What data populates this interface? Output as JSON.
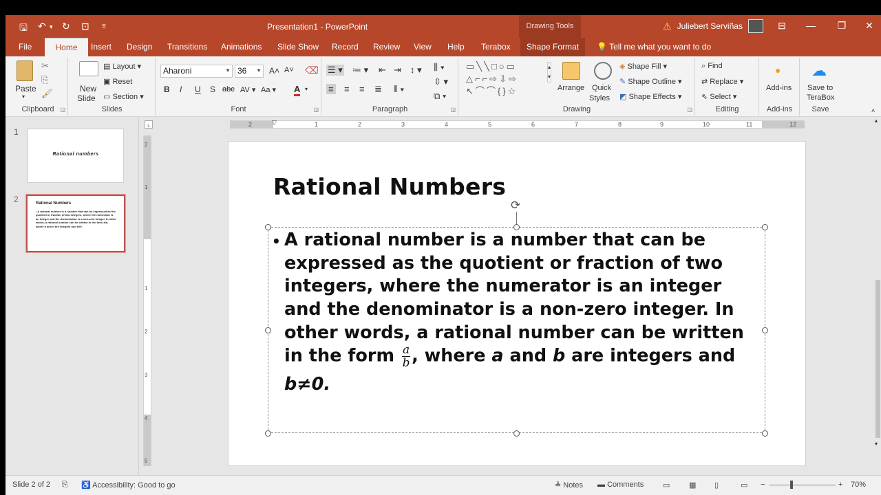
{
  "app": {
    "title": "Presentation1 - PowerPoint",
    "contextual_tab_group": "Drawing Tools",
    "user_name": "Juliebert Serviñas",
    "colors": {
      "brand": "#b7472a",
      "selection": "#c0504d"
    }
  },
  "tabs": [
    "File",
    "Home",
    "Insert",
    "Design",
    "Transitions",
    "Animations",
    "Slide Show",
    "Record",
    "Review",
    "View",
    "Help",
    "Terabox",
    "Shape Format"
  ],
  "active_tab": "Home",
  "tell_me": "Tell me what you want to do",
  "ribbon": {
    "clipboard": {
      "label": "Clipboard",
      "paste": "Paste"
    },
    "slides": {
      "label": "Slides",
      "new_slide": "New",
      "new_slide2": "Slide",
      "layout": "Layout",
      "reset": "Reset",
      "section": "Section"
    },
    "font": {
      "label": "Font",
      "family": "Aharoni",
      "size": "36",
      "bold": "B",
      "italic": "I",
      "underline": "U",
      "shadow": "S",
      "strike": "abc",
      "spacing": "AV",
      "case": "Aa",
      "color": "A"
    },
    "paragraph": {
      "label": "Paragraph"
    },
    "drawing": {
      "label": "Drawing",
      "arrange": "Arrange",
      "quick_styles": "Quick",
      "quick_styles2": "Styles",
      "shape_fill": "Shape Fill",
      "shape_outline": "Shape Outline",
      "shape_effects": "Shape Effects"
    },
    "editing": {
      "label": "Editing",
      "find": "Find",
      "replace": "Replace",
      "select": "Select"
    },
    "addins": {
      "label": "Add-ins",
      "addins": "Add-ins"
    },
    "save": {
      "label": "Save",
      "save_to": "Save to",
      "terabox": "TeraBox"
    }
  },
  "thumbnails": [
    {
      "number": "1",
      "title": "Rational numbers",
      "body": ""
    },
    {
      "number": "2",
      "title": "Rational Numbers",
      "body": "• A rational number is a number that can be expressed as the quotient or fraction of two integers, where the numerator is an integer and the denominator is a non-zero integer. In other words, a rational number can be written in the form a/b, where a and b are integers and b≠0."
    }
  ],
  "hruler_ticks": [
    "2",
    "1",
    "1",
    "2",
    "3",
    "4",
    "5",
    "6",
    "7",
    "8",
    "9",
    "10",
    "11",
    "12"
  ],
  "vruler_ticks": [
    "2",
    "1",
    "1",
    "2",
    "3",
    "4",
    "5"
  ],
  "slide": {
    "title": "Rational Numbers",
    "lines": {
      "l1": "A rational number is a number that can be",
      "l2": "expressed as the quotient or fraction of two",
      "l3": "integers, where the numerator is an integer",
      "l4": "and the denominator is a non-zero integer. In",
      "l5": "other words, a rational number can be written",
      "l6_a": "in the form ",
      "frac_num": "a",
      "frac_den": "b",
      "l6_b": ", where ",
      "var_a": "a",
      "l6_c": " and ",
      "var_b": "b",
      "l6_d": " are integers and",
      "l7": "b≠0."
    }
  },
  "status": {
    "slide_count": "Slide 2 of 2",
    "accessibility": "Accessibility: Good to go",
    "notes": "Notes",
    "comments": "Comments",
    "zoom": "70%"
  }
}
